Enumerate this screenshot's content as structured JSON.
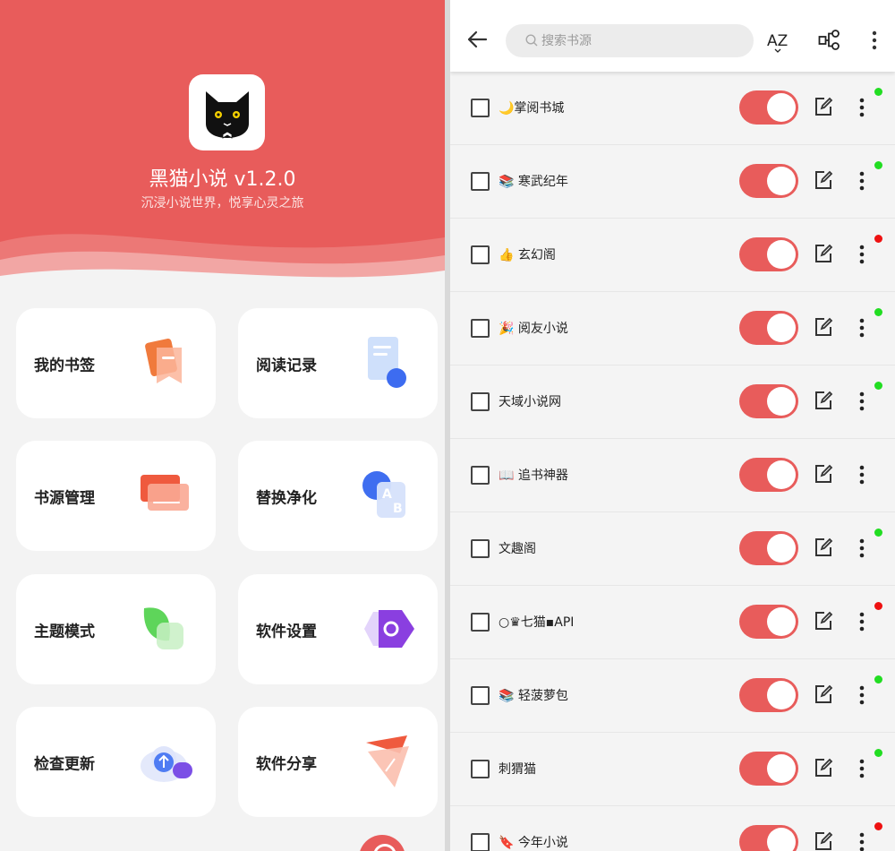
{
  "left": {
    "app_title": "黑猫小说 v1.2.0",
    "app_slogan": "沉浸小说世界，悦享心灵之旅",
    "brand_color": "#e85c5b",
    "cards": [
      {
        "label": "我的书签",
        "icon": "bookmark-icon"
      },
      {
        "label": "阅读记录",
        "icon": "reading-history-icon"
      },
      {
        "label": "书源管理",
        "icon": "book-source-icon"
      },
      {
        "label": "替换净化",
        "icon": "replace-icon"
      },
      {
        "label": "主题模式",
        "icon": "theme-icon"
      },
      {
        "label": "软件设置",
        "icon": "settings-icon"
      },
      {
        "label": "检查更新",
        "icon": "cloud-update-icon"
      },
      {
        "label": "软件分享",
        "icon": "share-icon"
      }
    ]
  },
  "right": {
    "search_placeholder": "搜索书源",
    "sort_label": "AZ",
    "status_colors": {
      "ok": "#22dd22",
      "error": "#ee1111"
    },
    "sources": [
      {
        "name": "🌙掌阅书城",
        "enabled": true,
        "status": "ok"
      },
      {
        "name": "📚 寒武纪年",
        "enabled": true,
        "status": "ok"
      },
      {
        "name": "👍 玄幻阁",
        "enabled": true,
        "status": "error"
      },
      {
        "name": "🎉 阅友小说",
        "enabled": true,
        "status": "ok"
      },
      {
        "name": "天域小说网",
        "enabled": true,
        "status": "ok"
      },
      {
        "name": "📖 追书神器",
        "enabled": true,
        "status": "none"
      },
      {
        "name": "文趣阁",
        "enabled": true,
        "status": "ok"
      },
      {
        "name": "○♛七猫▪API",
        "enabled": true,
        "status": "error"
      },
      {
        "name": "📚 轻菠萝包",
        "enabled": true,
        "status": "ok"
      },
      {
        "name": "刺猬猫",
        "enabled": true,
        "status": "ok"
      },
      {
        "name": "🔖 今年小说",
        "enabled": true,
        "status": "error"
      }
    ]
  }
}
